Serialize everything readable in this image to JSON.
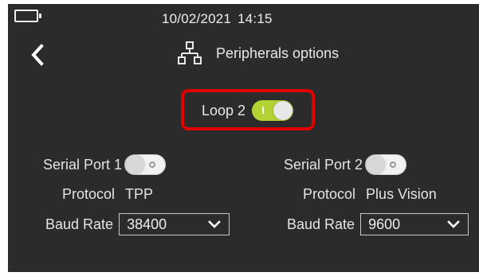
{
  "status": {
    "date": "10/02/2021",
    "time": "14:15",
    "battery_icon": "battery-icon"
  },
  "header": {
    "title": "Peripherals options",
    "back_icon": "chevron-left-icon",
    "title_icon": "network-icon"
  },
  "loop": {
    "label": "Loop 2",
    "enabled": true
  },
  "ports": [
    {
      "label": "Serial Port 1",
      "enabled": false,
      "protocol_label": "Protocol",
      "protocol": "TPP",
      "baud_label": "Baud Rate",
      "baud": "38400"
    },
    {
      "label": "Serial Port 2",
      "enabled": false,
      "protocol_label": "Protocol",
      "protocol": "Plus Vision",
      "baud_label": "Baud Rate",
      "baud": "9600"
    }
  ],
  "colors": {
    "background": "#2b2b2b",
    "toggle_on": "#b3d334",
    "highlight": "#e00000"
  }
}
